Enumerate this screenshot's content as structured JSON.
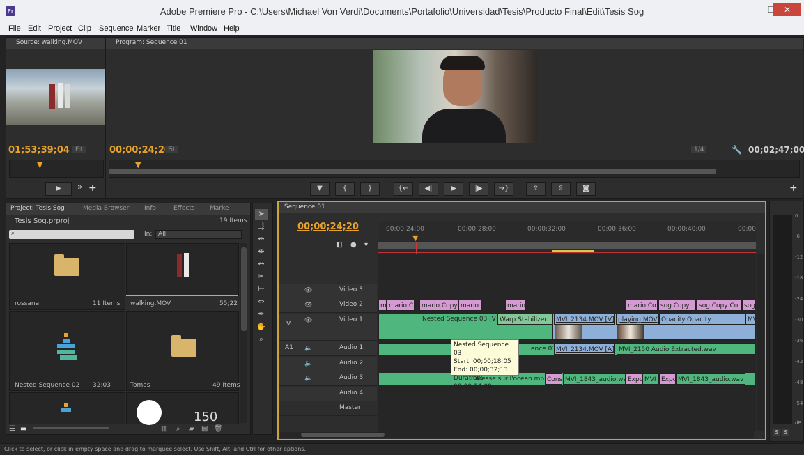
{
  "window": {
    "title": "Adobe Premiere Pro - C:\\Users\\Michael Von Verdi\\Documents\\Portafolio\\Universidad\\Tesis\\Producto Final\\Edit\\Tesis Sog",
    "app_icon": "Pr",
    "minimize": "–",
    "maximize": "☐",
    "close": "✕"
  },
  "menu": [
    "File",
    "Edit",
    "Project",
    "Clip",
    "Sequence",
    "Marker",
    "Title",
    "Window",
    "Help"
  ],
  "source": {
    "tab": "Source: walking.MOV",
    "timecode": "01;53;39;04",
    "fit": "Fit"
  },
  "program": {
    "tab": "Program: Sequence 01",
    "timecode": "00;00;24;20",
    "fit": "Fit",
    "res": "1/4",
    "duration": "00;02;47;00"
  },
  "project": {
    "tabs": [
      "Project: Tesis Sog",
      "Media Browser",
      "Info",
      "Effects",
      "Marke"
    ],
    "file": "Tesis Sog.prproj",
    "count": "19 Items",
    "search_placeholder": "",
    "in_label": "In:",
    "in_value": "All",
    "bins": [
      {
        "name": "rossana",
        "meta": "11 Items"
      },
      {
        "name": "walking.MOV",
        "meta": "55;22"
      },
      {
        "name": "Nested Sequence 02",
        "meta": "32;03"
      },
      {
        "name": "Tomas",
        "meta": "49 Items"
      }
    ],
    "bin5_text": "150"
  },
  "timeline": {
    "tab": "Sequence 01",
    "timecode": "00;00;24;20",
    "ruler": [
      "00;00;24;00",
      "00;00;28;00",
      "00;00;32;00",
      "00;00;36;00",
      "00;00;40;00",
      "00;00"
    ],
    "tracks": [
      "Video 3",
      "Video 2",
      "Video 1",
      "Audio 1",
      "Audio 2",
      "Audio 3",
      "Audio 4",
      "Master"
    ],
    "v_label": "V",
    "a_label": "A1",
    "video2_clips": [
      "m",
      "mario C",
      "mario Copy",
      "mario",
      "mario",
      "mario Co",
      "sog Copy",
      "sog Copy Co",
      "sog"
    ],
    "video1_clips": [
      "Nested Sequence 03 [V]",
      "Warp Stabilizer:",
      "MVI_2134.MOV [V]",
      "playing.MOV",
      "Opacity:Opacity",
      "MV"
    ],
    "audio1_clips": [
      "ence 03 [A]",
      "MVI_2134.MOV [A]",
      "MVI_2150 Audio Extracted.wav"
    ],
    "audio3_clips": [
      "Caresse sur l'océan.mp3",
      "Cons",
      "MVI_1843_audio.wa",
      "Expo",
      "MVI",
      "Expo",
      "MVI_1843_audio.wav"
    ],
    "tooltip": {
      "name": "Nested Sequence 03",
      "start": "Start: 00;00;18;05",
      "end": "End: 00;00;32;13",
      "duration": "Duration: 00;00;14;09"
    }
  },
  "meter": {
    "ticks": [
      "0",
      "-6",
      "-12",
      "-18",
      "-24",
      "-30",
      "-36",
      "-42",
      "-48",
      "-54",
      "dB"
    ],
    "solo": [
      "S",
      "S"
    ]
  },
  "status": "Click to select, or click in empty space and drag to marquee select. Use Shift, Alt, and Ctrl for other options."
}
